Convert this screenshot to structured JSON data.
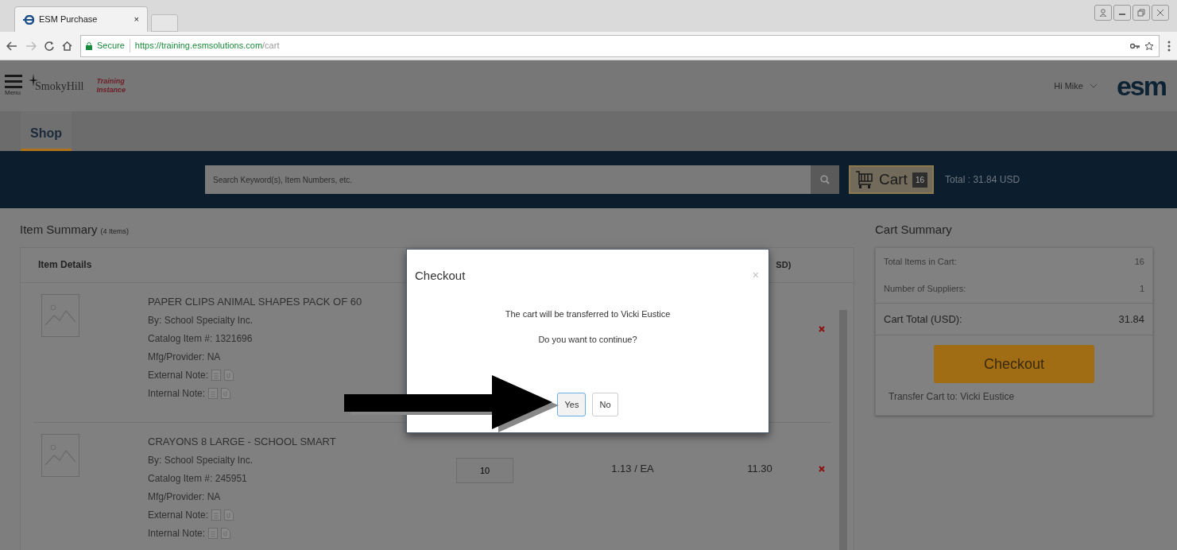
{
  "browser": {
    "tab_title": "ESM Purchase",
    "tab_close": "×",
    "secure_label": "Secure",
    "url_host": "https://training.esmsolutions.com",
    "url_path": "/cart"
  },
  "header": {
    "menu_label": "Menu",
    "logo_text": "SmokyHill",
    "instance_label": "Training Instance",
    "greeting": "Hi Mike",
    "brand": "esm"
  },
  "nav_tabs": [
    {
      "label": "Shop",
      "selected": true
    }
  ],
  "search": {
    "placeholder": "Search Keyword(s), Item Numbers, etc."
  },
  "cart_button": {
    "label": "Cart",
    "count": "16"
  },
  "cart_total": "Total : 31.84 USD",
  "item_summary": {
    "title": "Item Summary",
    "count": "(4 Items)",
    "columns": [
      "Item Details",
      "SD)"
    ],
    "items": [
      {
        "name": "PAPER CLIPS ANIMAL SHAPES PACK OF 60",
        "supplier": "By: School Specialty Inc.",
        "catalog": "Catalog Item #: 1321696",
        "mfg": "Mfg/Provider: NA",
        "external_note": "External Note:",
        "internal_note": "Internal Note:"
      },
      {
        "name": "CRAYONS 8 LARGE - SCHOOL SMART",
        "supplier": "By: School Specialty Inc.",
        "catalog": "Catalog Item #: 245951",
        "mfg": "Mfg/Provider: NA",
        "external_note": "External Note:",
        "internal_note": "Internal Note:",
        "quantity": "10",
        "price": "1.13 / EA",
        "total": "11.30"
      }
    ]
  },
  "cart_summary": {
    "title": "Cart Summary",
    "rows": [
      {
        "label": "Total Items in Cart:",
        "value": "16"
      },
      {
        "label": "Number of Suppliers:",
        "value": "1"
      }
    ],
    "total": {
      "label": "Cart Total (USD):",
      "value": "31.84"
    },
    "checkout_label": "Checkout",
    "transfer_note": "Transfer Cart to: Vicki Eustice"
  },
  "dialog": {
    "title": "Checkout",
    "close": "×",
    "lines": [
      "The cart will be transferred to Vicki Eustice",
      "Do you want to continue?"
    ],
    "buttons": [
      {
        "label": "Yes",
        "focused": true
      },
      {
        "label": "No",
        "focused": false
      }
    ]
  }
}
